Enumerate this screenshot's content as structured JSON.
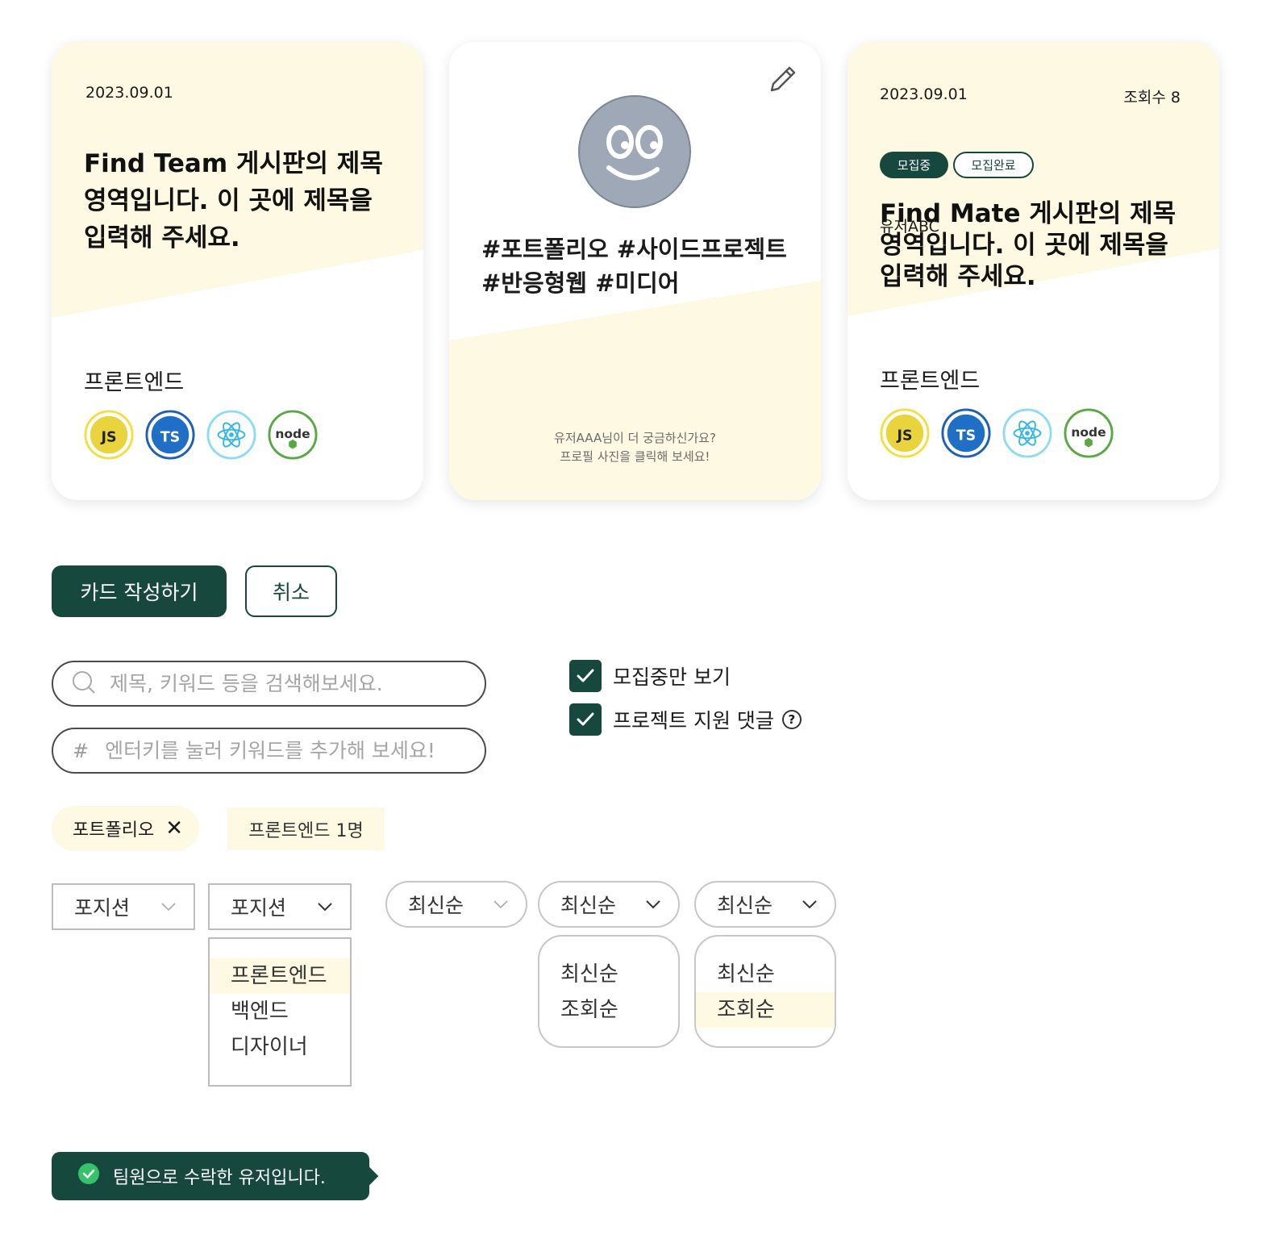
{
  "colors": {
    "accent": "#16483e",
    "cream": "#fdf9e3",
    "avatar": "#9ea8b6"
  },
  "card_team": {
    "date": "2023.09.01",
    "title": "Find Team 게시판의 제목 영역입니다. 이 곳에 제목을 입력해 주세요.",
    "position": "프론트엔드",
    "stack": [
      "js",
      "ts",
      "react",
      "node"
    ]
  },
  "card_profile": {
    "edit_icon": "pencil-icon",
    "hashtags": "#포트폴리오 #사이드프로젝트 #반응형웹 #미디어",
    "hint_line1": "유저AAA님이 더 궁금하신가요?",
    "hint_line2": "프로필 사진을 클릭해 보세요!"
  },
  "card_mate": {
    "date": "2023.09.01",
    "views": "조회수 8",
    "badge_recruiting": "모집중",
    "badge_done": "모집완료",
    "author": "유저ABC",
    "title": "Find Mate 게시판의 제목 영역입니다. 이 곳에 제목을 입력해 주세요.",
    "position": "프론트엔드",
    "stack": [
      "js",
      "ts",
      "react",
      "node"
    ]
  },
  "buttons": {
    "write": "카드 작성하기",
    "cancel": "취소"
  },
  "search": {
    "placeholder": "제목, 키워드 등을 검색해보세요.",
    "value": ""
  },
  "keyword": {
    "prefix": "#",
    "placeholder": "엔터키를 눌러 키워드를 추가해 보세요!",
    "value": ""
  },
  "filters": {
    "recruiting_only": {
      "label": "모집중만 보기",
      "checked": true
    },
    "project_apply": {
      "label": "프로젝트 지원 댓글",
      "checked": true,
      "help": "?"
    }
  },
  "chips": {
    "tag": "포트폴리오",
    "tag_remove": "✕",
    "position": "프론트엔드 1명"
  },
  "selects": {
    "position1": "포지션",
    "position2": "포지션",
    "sort1": "최신순",
    "sort2": "최신순",
    "sort3": "최신순"
  },
  "position_options": [
    "프론트엔드",
    "백엔드",
    "디자이너"
  ],
  "sort_options": [
    "최신순",
    "조회순"
  ],
  "toast": {
    "message": "팀원으로 수락한 유저입니다."
  }
}
